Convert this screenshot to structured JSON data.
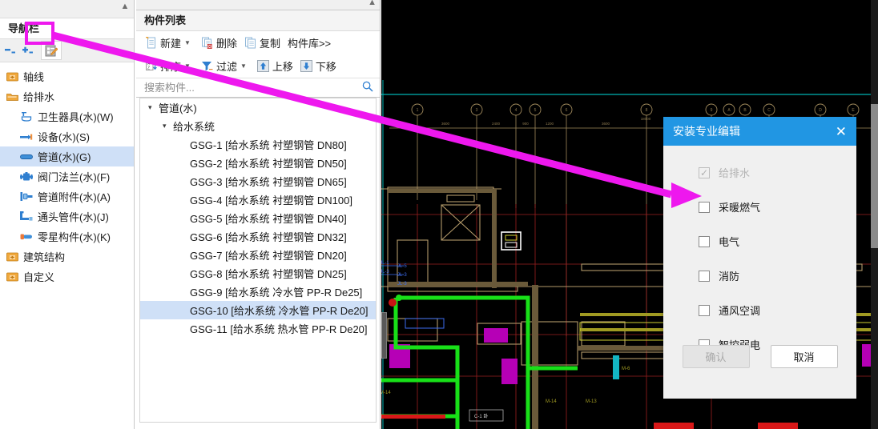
{
  "nav": {
    "title": "导航栏",
    "collapse_icon": "collapse-caret-icon",
    "toolbar": [
      {
        "name": "collapse-all-icon",
        "label": "-"
      },
      {
        "name": "expand-all-icon",
        "label": "+"
      },
      {
        "name": "document-edit-icon",
        "label": "安装专业编辑"
      }
    ],
    "items": [
      {
        "label": "轴线",
        "icon": "folder-collapsed-icon",
        "level": 1,
        "selected": false
      },
      {
        "label": "给排水",
        "icon": "folder-open-icon",
        "level": 1,
        "selected": false
      },
      {
        "label": "卫生器具(水)(W)",
        "icon": "sanitary-fixture-icon",
        "level": 2,
        "selected": false
      },
      {
        "label": "设备(水)(S)",
        "icon": "equipment-icon",
        "level": 2,
        "selected": false
      },
      {
        "label": "管道(水)(G)",
        "icon": "pipe-icon",
        "level": 2,
        "selected": true
      },
      {
        "label": "阀门法兰(水)(F)",
        "icon": "valve-flange-icon",
        "level": 2,
        "selected": false
      },
      {
        "label": "管道附件(水)(A)",
        "icon": "pipe-accessory-icon",
        "level": 2,
        "selected": false
      },
      {
        "label": "通头管件(水)(J)",
        "icon": "pipe-fitting-icon",
        "level": 2,
        "selected": false
      },
      {
        "label": "零星构件(水)(K)",
        "icon": "misc-component-icon",
        "level": 2,
        "selected": false
      },
      {
        "label": "建筑结构",
        "icon": "folder-collapsed-icon",
        "level": 1,
        "selected": false
      },
      {
        "label": "自定义",
        "icon": "folder-collapsed-icon",
        "level": 1,
        "selected": false
      }
    ]
  },
  "list": {
    "title": "构件列表",
    "collapse_icon": "collapse-caret-icon",
    "toolbar_row1": [
      {
        "label": "新建",
        "icon": "new-file-icon",
        "caret": true
      },
      {
        "label": "删除",
        "icon": "delete-file-icon",
        "caret": false
      },
      {
        "label": "复制",
        "icon": "copy-file-icon",
        "caret": false
      },
      {
        "label": "构件库>>",
        "icon": "",
        "caret": false
      }
    ],
    "toolbar_row2": [
      {
        "label": "排序",
        "icon": "sort-az-icon",
        "caret": true
      },
      {
        "label": "过滤",
        "icon": "filter-icon",
        "caret": true
      },
      {
        "label": "上移",
        "icon": "arrow-up-icon",
        "caret": false
      },
      {
        "label": "下移",
        "icon": "arrow-down-icon",
        "caret": false
      }
    ],
    "search_placeholder": "搜索构件...",
    "search_value": "",
    "search_icon": "search-icon",
    "tree": [
      {
        "label": "管道(水)",
        "level": 0,
        "expanded": true,
        "selected": false
      },
      {
        "label": "给水系统",
        "level": 1,
        "expanded": true,
        "selected": false
      },
      {
        "label": "GSG-1 [给水系统 衬塑钢管 DN80]",
        "level": 2,
        "expanded": false,
        "selected": false
      },
      {
        "label": "GSG-2 [给水系统 衬塑钢管 DN50]",
        "level": 2,
        "expanded": false,
        "selected": false
      },
      {
        "label": "GSG-3 [给水系统 衬塑钢管 DN65]",
        "level": 2,
        "expanded": false,
        "selected": false
      },
      {
        "label": "GSG-4 [给水系统 衬塑钢管 DN100]",
        "level": 2,
        "expanded": false,
        "selected": false
      },
      {
        "label": "GSG-5 [给水系统 衬塑钢管 DN40]",
        "level": 2,
        "expanded": false,
        "selected": false
      },
      {
        "label": "GSG-6 [给水系统 衬塑钢管 DN32]",
        "level": 2,
        "expanded": false,
        "selected": false
      },
      {
        "label": "GSG-7 [给水系统 衬塑钢管 DN20]",
        "level": 2,
        "expanded": false,
        "selected": false
      },
      {
        "label": "GSG-8 [给水系统 衬塑钢管 DN25]",
        "level": 2,
        "expanded": false,
        "selected": false
      },
      {
        "label": "GSG-9 [给水系统 冷水管 PP-R De25]",
        "level": 2,
        "expanded": false,
        "selected": false
      },
      {
        "label": "GSG-10 [给水系统 冷水管 PP-R De20]",
        "level": 2,
        "expanded": false,
        "selected": true
      },
      {
        "label": "GSG-11 [给水系统 热水管 PP-R De20]",
        "level": 2,
        "expanded": false,
        "selected": false
      }
    ]
  },
  "dialog": {
    "title": "安装专业编辑",
    "close_icon": "close-icon",
    "accent_color": "#2196e3",
    "checkboxes": [
      {
        "label": "给排水",
        "checked": true,
        "disabled": true
      },
      {
        "label": "采暖燃气",
        "checked": false,
        "disabled": false
      },
      {
        "label": "电气",
        "checked": false,
        "disabled": false
      },
      {
        "label": "消防",
        "checked": false,
        "disabled": false
      },
      {
        "label": "通风空调",
        "checked": false,
        "disabled": false
      },
      {
        "label": "智控弱电",
        "checked": false,
        "disabled": false
      }
    ],
    "confirm_label": "确认",
    "confirm_disabled": true,
    "cancel_label": "取消"
  },
  "annotation": {
    "highlight_color": "#ee18ee",
    "arrow_from": "document-edit-icon",
    "arrow_to": "安装专业编辑"
  }
}
